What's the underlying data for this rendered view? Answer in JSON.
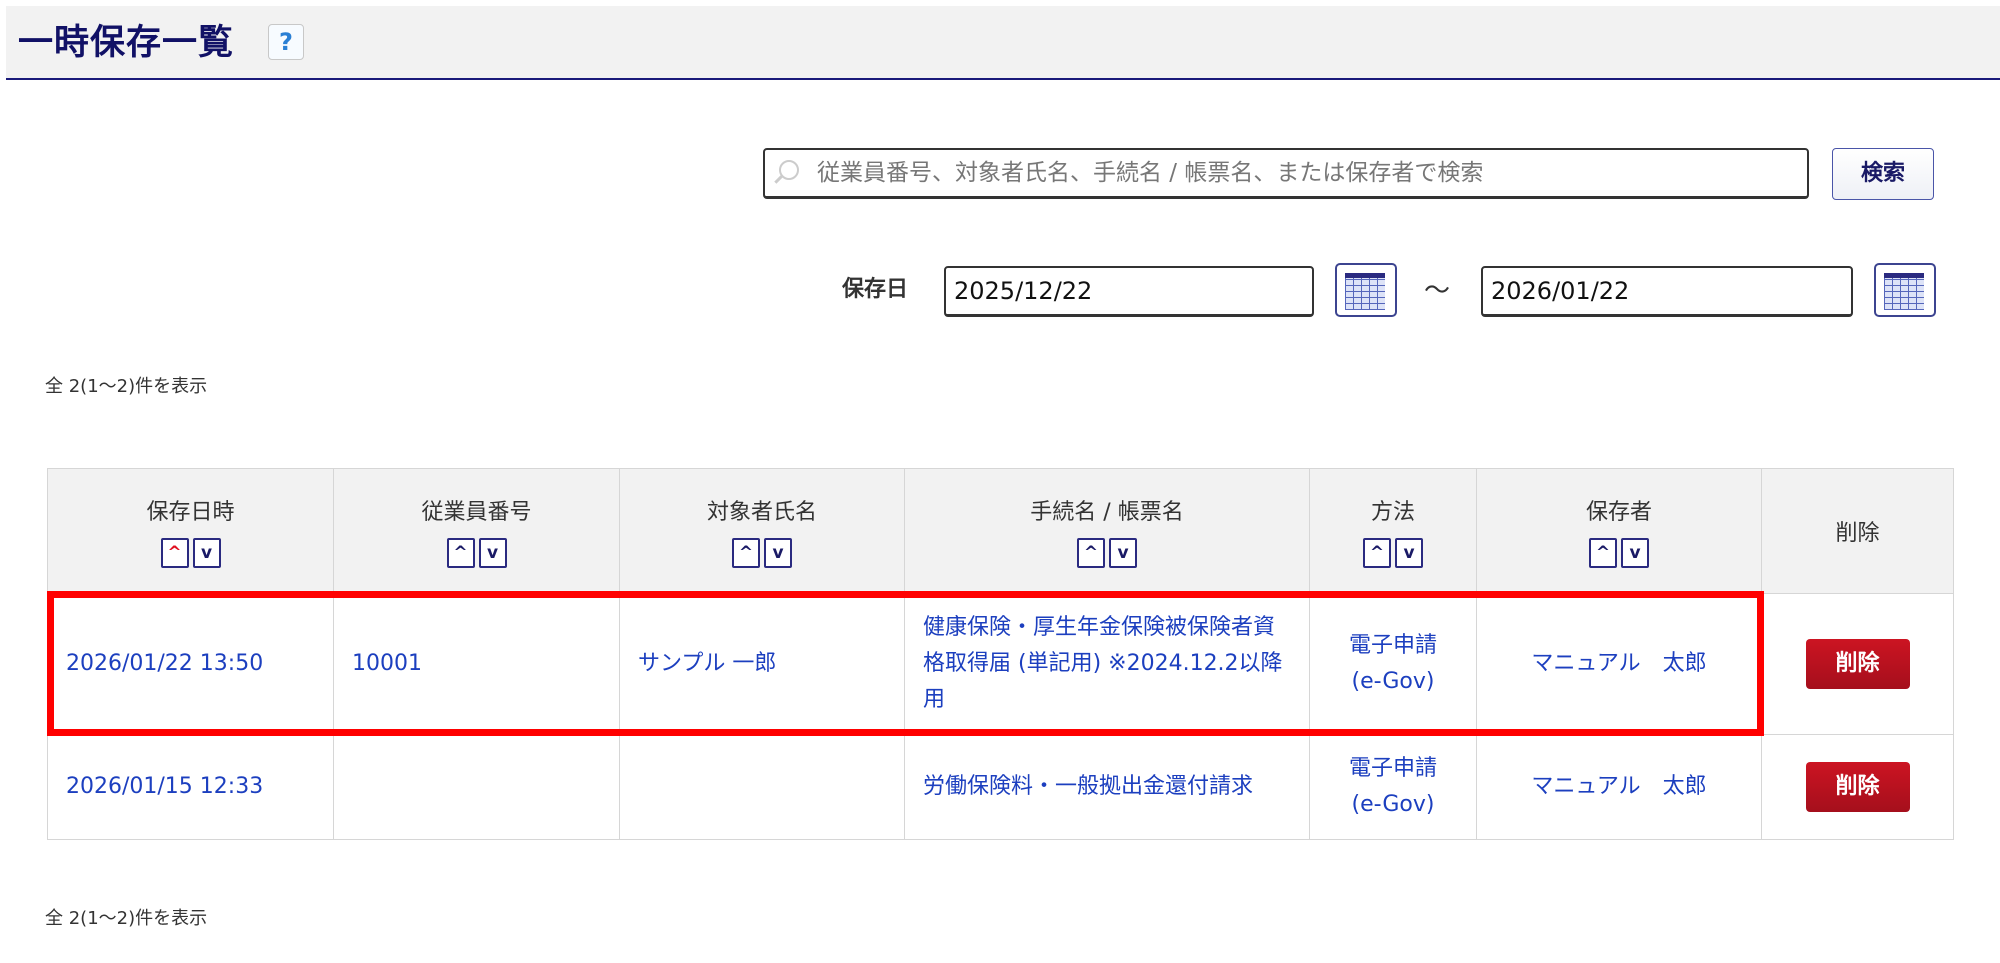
{
  "header": {
    "title": "一時保存一覧",
    "help_label": "?"
  },
  "search": {
    "placeholder": "従業員番号、対象者氏名、手続名 / 帳票名、または保存者で検索",
    "button_label": "検索"
  },
  "date_filter": {
    "label": "保存日",
    "from": "2025/12/22",
    "separator": "～",
    "to": "2026/01/22"
  },
  "result_count": "全 2(1～2)件を表示",
  "table": {
    "columns": [
      "保存日時",
      "従業員番号",
      "対象者氏名",
      "手続名 / 帳票名",
      "方法",
      "保存者",
      "削除"
    ],
    "sort_up": "^",
    "sort_down": "v",
    "rows": [
      {
        "saved_at": "2026/01/22 13:50",
        "employee_no": "10001",
        "name": "サンプル 一郎",
        "procedure": "健康保険・厚生年金保険被保険者資格取得届 (単記用) ※2024.12.2以降用",
        "method_1": "電子申請",
        "method_2": "(e-Gov)",
        "saver": "マニュアル　太郎",
        "delete_label": "削除"
      },
      {
        "saved_at": "2026/01/15 12:33",
        "employee_no": "",
        "name": "",
        "procedure": "労働保険料・一般拠出金還付請求",
        "method_1": "電子申請",
        "method_2": "(e-Gov)",
        "saver": "マニュアル　太郎",
        "delete_label": "削除"
      }
    ]
  },
  "colors": {
    "link": "#1c3fbf",
    "highlight": "#ff0000",
    "delete": "#b5121f",
    "title": "#111166"
  }
}
